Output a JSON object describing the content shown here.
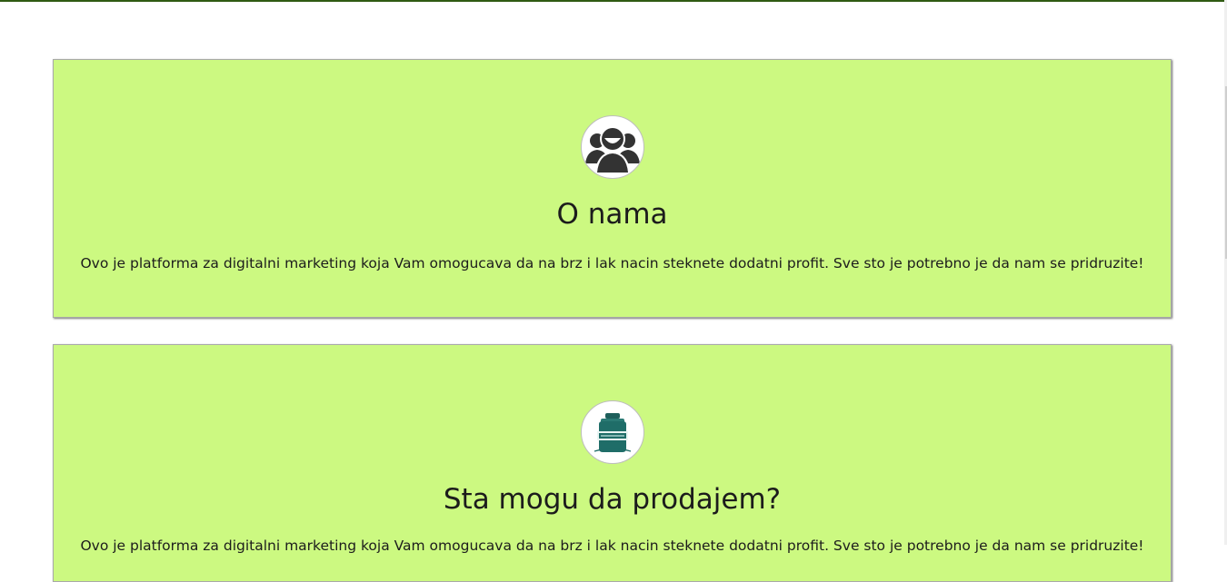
{
  "colors": {
    "top_line": "#2f5a12",
    "card_background": "#ccf981"
  },
  "cards": [
    {
      "icon": "people-group-icon",
      "title": "O nama",
      "text": "Ovo je platforma za digitalni marketing koja Vam omogucava da na brz i lak nacin steknete dodatni profit. Sve sto je potrebno je da nam se pridruzite!"
    },
    {
      "icon": "product-jar-icon",
      "title": "Sta mogu da prodajem?",
      "text": "Ovo je platforma za digitalni marketing koja Vam omogucava da na brz i lak nacin steknete dodatni profit. Sve sto je potrebno je da nam se pridruzite!"
    }
  ]
}
